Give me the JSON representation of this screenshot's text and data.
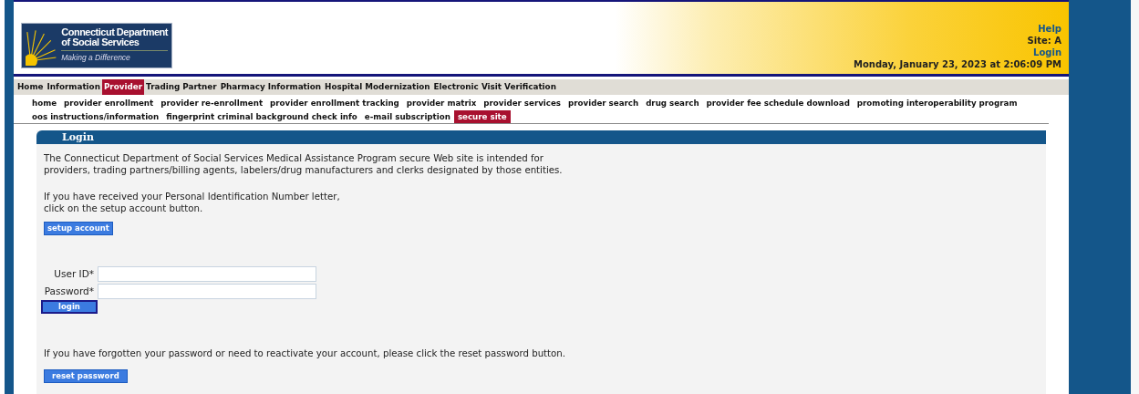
{
  "logo": {
    "line_1": "Connecticut Department",
    "line_2": "of Social Services",
    "tagline": "Making a Difference"
  },
  "header_links": [
    {
      "kind": "link",
      "text": "Help"
    },
    {
      "kind": "label",
      "text": "Site: A"
    },
    {
      "kind": "link",
      "text": "Login"
    },
    {
      "kind": "label",
      "text": "Monday, January 23, 2023 at 2:06:09 PM"
    }
  ],
  "main_nav": [
    {
      "label": "Home",
      "selected": false
    },
    {
      "label": "Information",
      "selected": false
    },
    {
      "label": "Provider",
      "selected": true
    },
    {
      "label": "Trading Partner",
      "selected": false
    },
    {
      "label": "Pharmacy Information",
      "selected": false
    },
    {
      "label": "Hospital Modernization",
      "selected": false
    },
    {
      "label": "Electronic Visit Verification",
      "selected": false
    }
  ],
  "sub_nav": [
    {
      "label": "home",
      "selected": false
    },
    {
      "label": "provider enrollment",
      "selected": false
    },
    {
      "label": "provider re-enrollment",
      "selected": false
    },
    {
      "label": "provider enrollment tracking",
      "selected": false
    },
    {
      "label": "provider matrix",
      "selected": false
    },
    {
      "label": "provider services",
      "selected": false
    },
    {
      "label": "provider search",
      "selected": false
    },
    {
      "label": "drug search",
      "selected": false
    },
    {
      "label": "provider fee schedule download",
      "selected": false
    },
    {
      "label": "promoting interoperability program",
      "selected": false
    },
    {
      "label": "oos instructions/information",
      "selected": false
    },
    {
      "label": "fingerprint criminal background check info",
      "selected": false
    },
    {
      "label": "e-mail subscription",
      "selected": false
    },
    {
      "label": "secure site",
      "selected": true
    }
  ],
  "panel": {
    "title": "Login",
    "intro": [
      "The Connecticut Department of Social Services Medical Assistance Program secure Web site is intended for",
      "providers, trading partners/billing agents, labelers/drug manufacturers and clerks designated by those entities."
    ],
    "pin_text": [
      "If you have received your Personal Identification Number letter,",
      "click on the setup account button."
    ],
    "setup_button": "setup account",
    "fields": [
      {
        "label": "User ID*"
      },
      {
        "label": "Password*"
      }
    ],
    "login_button": "login",
    "reset_text": "If you have forgotten your password or need to reactivate your account, please click the reset password button.",
    "reset_button": "reset password"
  }
}
